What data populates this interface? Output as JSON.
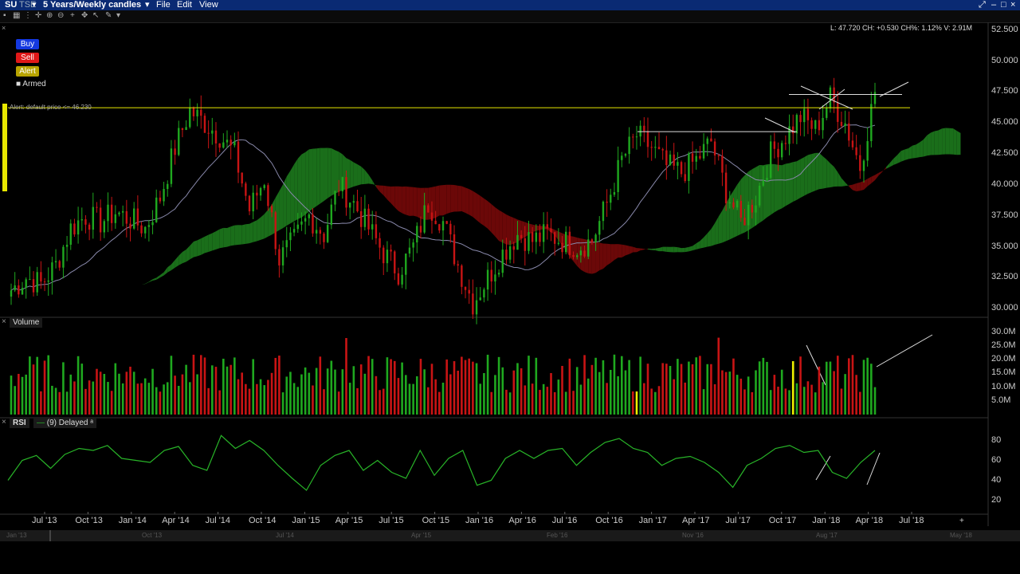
{
  "menubar": {
    "symbol": "SU",
    "exchange": "TSE",
    "period": "5 Years/Weekly candles",
    "file": "File",
    "edit": "Edit",
    "view": "View"
  },
  "order_buttons": {
    "buy": "Buy",
    "sell": "Sell",
    "alert": "Alert",
    "armed": "Armed"
  },
  "alert_line_label": "Alert: default price <= 46.230",
  "quote_readout": "L: 47.720 CH: +0.530 CH%: 1.12% V: 2.91M",
  "panels": {
    "volume": "Volume",
    "rsi": "RSI",
    "rsi_settings": "(9) Delayed"
  },
  "colors": {
    "up": "#1fa81f",
    "down": "#c81414",
    "cloud_bull": "#1a6e1a",
    "cloud_bear": "#6b0808",
    "alert_line": "#e8e800",
    "rsi_line": "#28b428",
    "menubar": "#0a2a73"
  },
  "chart_data": [
    {
      "type": "candlestick",
      "title": "SU TSE 5 Years/Weekly candles",
      "x_ticks": [
        "Jul '13",
        "Oct '13",
        "Jan '14",
        "Apr '14",
        "Jul '14",
        "Oct '14",
        "Jan '15",
        "Apr '15",
        "Jul '15",
        "Oct '15",
        "Jan '16",
        "Apr '16",
        "Jul '16",
        "Oct '16",
        "Jan '17",
        "Apr '17",
        "Jul '17",
        "Oct '17",
        "Jan '18",
        "Apr '18",
        "Jul '18"
      ],
      "y_ticks": [
        "52.500",
        "50.000",
        "47.500",
        "45.000",
        "42.500",
        "40.000",
        "37.500",
        "35.000",
        "32.500",
        "30.000"
      ],
      "ylim": [
        29.5,
        53
      ],
      "alert_level": 46.23,
      "close_path": [
        [
          "Jun '13",
          31.5
        ],
        [
          "Jul '13",
          32.5
        ],
        [
          "Aug '13",
          32.0
        ],
        [
          "Sep '13",
          33.5
        ],
        [
          "Oct '13",
          36.5
        ],
        [
          "Nov '13",
          37.5
        ],
        [
          "Dec '13",
          37.0
        ],
        [
          "Jan '14",
          37.8
        ],
        [
          "Feb '14",
          37.2
        ],
        [
          "Mar '14",
          36.5
        ],
        [
          "Apr '14",
          39.0
        ],
        [
          "May '14",
          43.0
        ],
        [
          "Jun '14",
          46.0
        ],
        [
          "Jul '14",
          45.0
        ],
        [
          "Aug '14",
          44.0
        ],
        [
          "Sep '14",
          42.5
        ],
        [
          "Oct '14",
          38.0
        ],
        [
          "Nov '14",
          40.5
        ],
        [
          "Dec '14",
          34.0
        ],
        [
          "Jan '15",
          35.5
        ],
        [
          "Feb '15",
          37.5
        ],
        [
          "Mar '15",
          36.0
        ],
        [
          "Apr '15",
          40.0
        ],
        [
          "May '15",
          38.5
        ],
        [
          "Jun '15",
          36.5
        ],
        [
          "Jul '15",
          34.5
        ],
        [
          "Aug '15",
          33.0
        ],
        [
          "Sep '15",
          35.0
        ],
        [
          "Oct '15",
          38.5
        ],
        [
          "Nov '15",
          37.0
        ],
        [
          "Dec '15",
          33.5
        ],
        [
          "Jan '16",
          30.5
        ],
        [
          "Feb '16",
          32.5
        ],
        [
          "Mar '16",
          34.5
        ],
        [
          "Apr '16",
          36.0
        ],
        [
          "May '16",
          35.5
        ],
        [
          "Jun '16",
          36.0
        ],
        [
          "Jul '16",
          35.5
        ],
        [
          "Aug '16",
          35.0
        ],
        [
          "Sep '16",
          35.5
        ],
        [
          "Oct '16",
          38.5
        ],
        [
          "Nov '16",
          42.0
        ],
        [
          "Dec '16",
          44.0
        ],
        [
          "Jan '17",
          43.0
        ],
        [
          "Feb '17",
          41.5
        ],
        [
          "Mar '17",
          41.0
        ],
        [
          "Apr '17",
          42.0
        ],
        [
          "May '17",
          43.5
        ],
        [
          "Jun '17",
          39.5
        ],
        [
          "Jul '17",
          37.0
        ],
        [
          "Aug '17",
          39.0
        ],
        [
          "Sep '17",
          42.5
        ],
        [
          "Oct '17",
          44.0
        ],
        [
          "Nov '17",
          45.5
        ],
        [
          "Dec '17",
          44.5
        ],
        [
          "Jan '18",
          47.0
        ],
        [
          "Feb '18",
          45.0
        ],
        [
          "Mar '18",
          41.5
        ],
        [
          "Apr '18",
          47.5
        ]
      ]
    },
    {
      "type": "bar",
      "title": "Volume",
      "y_ticks": [
        "30.0M",
        "25.0M",
        "20.0M",
        "15.0M",
        "10.0M",
        "5.0M"
      ],
      "ylim": [
        0,
        32
      ]
    },
    {
      "type": "line",
      "title": "RSI",
      "y_ticks": [
        "80",
        "60",
        "40",
        "20"
      ],
      "ylim": [
        10,
        90
      ],
      "values": [
        40,
        60,
        65,
        52,
        66,
        72,
        70,
        75,
        62,
        60,
        58,
        70,
        74,
        55,
        50,
        85,
        72,
        80,
        70,
        55,
        42,
        30,
        55,
        65,
        70,
        50,
        60,
        48,
        42,
        70,
        45,
        62,
        70,
        35,
        40,
        62,
        70,
        62,
        70,
        72,
        55,
        68,
        78,
        82,
        72,
        68,
        55,
        62,
        64,
        58,
        48,
        33,
        55,
        62,
        72,
        75,
        68,
        70,
        48,
        42,
        58,
        70
      ]
    }
  ]
}
